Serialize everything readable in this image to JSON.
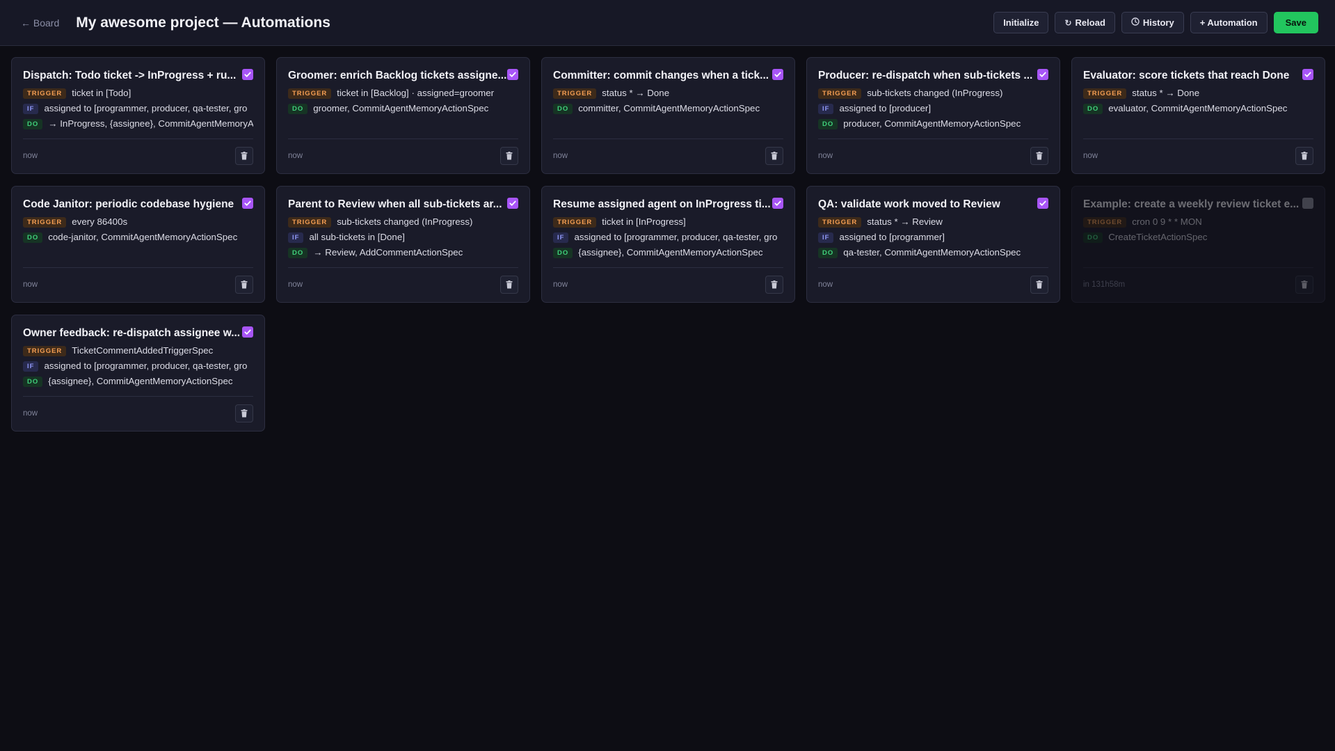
{
  "header": {
    "back_label": "← Board",
    "title": "My awesome project — Automations",
    "buttons": {
      "initialize": "Initialize",
      "reload": "Reload",
      "history": "History",
      "automation": "+ Automation",
      "save": "Save"
    }
  },
  "tags": {
    "trigger": "TRIGGER",
    "if": "IF",
    "do": "DO"
  },
  "cards": [
    {
      "title": "Dispatch: Todo ticket -> InProgress + ru...",
      "enabled": true,
      "trigger": "ticket in [Todo]",
      "if": "assigned to [programmer, producer, qa-tester, gro",
      "do": "→ InProgress, {assignee}, CommitAgentMemoryA",
      "time": "now"
    },
    {
      "title": "Groomer: enrich Backlog tickets assigne...",
      "enabled": true,
      "trigger": "ticket in [Backlog] · assigned=groomer",
      "if": null,
      "do": "groomer, CommitAgentMemoryActionSpec",
      "time": "now"
    },
    {
      "title": "Committer: commit changes when a tick...",
      "enabled": true,
      "trigger": "status * → Done",
      "if": null,
      "do": "committer, CommitAgentMemoryActionSpec",
      "time": "now"
    },
    {
      "title": "Producer: re-dispatch when sub-tickets ...",
      "enabled": true,
      "trigger": "sub-tickets changed (InProgress)",
      "if": "assigned to [producer]",
      "do": "producer, CommitAgentMemoryActionSpec",
      "time": "now"
    },
    {
      "title": "Evaluator: score tickets that reach Done",
      "enabled": true,
      "trigger": "status * → Done",
      "if": null,
      "do": "evaluator, CommitAgentMemoryActionSpec",
      "time": "now"
    },
    {
      "title": "Code Janitor: periodic codebase hygiene",
      "enabled": true,
      "trigger": "every 86400s",
      "if": null,
      "do": "code-janitor, CommitAgentMemoryActionSpec",
      "time": "now"
    },
    {
      "title": "Parent to Review when all sub-tickets ar...",
      "enabled": true,
      "trigger": "sub-tickets changed (InProgress)",
      "if": "all sub-tickets in [Done]",
      "do": "→ Review, AddCommentActionSpec",
      "time": "now"
    },
    {
      "title": "Resume assigned agent on InProgress ti...",
      "enabled": true,
      "trigger": "ticket in [InProgress]",
      "if": "assigned to [programmer, producer, qa-tester, gro",
      "do": "{assignee}, CommitAgentMemoryActionSpec",
      "time": "now"
    },
    {
      "title": "QA: validate work moved to Review",
      "enabled": true,
      "trigger": "status * → Review",
      "if": "assigned to [programmer]",
      "do": "qa-tester, CommitAgentMemoryActionSpec",
      "time": "now"
    },
    {
      "title": "Example: create a weekly review ticket e...",
      "enabled": false,
      "trigger": "cron 0 9 * * MON",
      "if": null,
      "do": "CreateTicketActionSpec",
      "time": "in 131h58m"
    },
    {
      "title": "Owner feedback: re-dispatch assignee w...",
      "enabled": true,
      "trigger": "TicketCommentAddedTriggerSpec",
      "if": "assigned to [programmer, producer, qa-tester, gro",
      "do": "{assignee}, CommitAgentMemoryActionSpec",
      "time": "now"
    }
  ],
  "colors": {
    "accent_checkbox": "#a855f7",
    "save_button": "#22c55e",
    "trigger_tag": "#f59e52",
    "if_tag": "#8f97f5",
    "do_tag": "#3fcf7a"
  }
}
